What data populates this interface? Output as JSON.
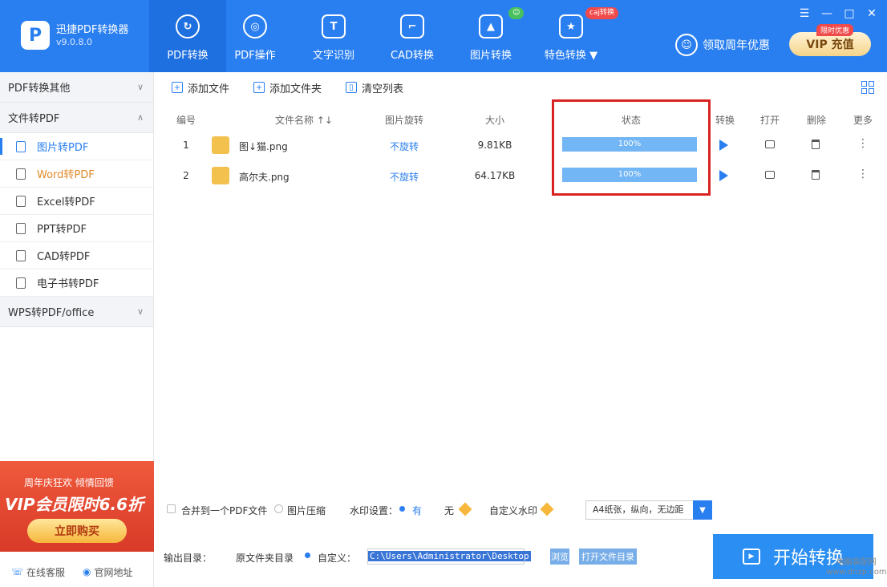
{
  "app": {
    "name": "迅捷PDF转换器",
    "version": "v9.0.8.0",
    "logo_letter": "P"
  },
  "nav": [
    {
      "label": "PDF转换",
      "icon": "refresh-icon"
    },
    {
      "label": "PDF操作",
      "icon": "target-icon"
    },
    {
      "label": "文字识别",
      "icon": "text-scan-icon"
    },
    {
      "label": "CAD转换",
      "icon": "cad-icon"
    },
    {
      "label": "图片转换",
      "icon": "image-icon"
    },
    {
      "label": "特色转换",
      "icon": "star-icon",
      "chevron": "▼"
    }
  ],
  "badges": {
    "green": "☺",
    "red": "caj转换"
  },
  "promo": {
    "text": "领取周年优惠",
    "vip_label": "VIP 充值",
    "vip_tag": "限时优惠"
  },
  "window_controls": {
    "menu": "☰",
    "minimize": "—",
    "maximize": "□",
    "close": "✕"
  },
  "sidebar": {
    "group1": "PDF转换其他",
    "group2": "文件转PDF",
    "items": [
      "图片转PDF",
      "Word转PDF",
      "Excel转PDF",
      "PPT转PDF",
      "CAD转PDF",
      "电子书转PDF"
    ],
    "group3": "WPS转PDF/office",
    "ad": {
      "line1": "周年庆狂欢 倾情回馈",
      "line2": "VIP会员限时6.6折",
      "button": "立即购买"
    },
    "footer": {
      "support": "在线客服",
      "website": "官网地址"
    }
  },
  "toolbar": {
    "add_file": "添加文件",
    "add_folder": "添加文件夹",
    "clear_list": "清空列表"
  },
  "table": {
    "headers": {
      "num": "编号",
      "name": "文件名称",
      "sort": "↑↓",
      "rotate": "图片旋转",
      "size": "大小",
      "status": "状态",
      "convert": "转换",
      "open": "打开",
      "delete": "删除",
      "more": "更多"
    },
    "rows": [
      {
        "num": "1",
        "name": "图↓猫.png",
        "rotate": "不旋转",
        "size": "9.81KB",
        "progress": 100,
        "status": "100%"
      },
      {
        "num": "2",
        "name": "高尔夫.png",
        "rotate": "不旋转",
        "size": "64.17KB",
        "progress": 100,
        "status": "100%"
      }
    ]
  },
  "options": {
    "merge": "合并到一个PDF文件",
    "compress": "图片压缩",
    "watermark_label": "水印设置：",
    "watermark_yes": "有",
    "watermark_no": "无",
    "custom_watermark": "自定义水印",
    "page_setting": "A4纸张，纵向，无边距",
    "dropdown_arrow": "▼"
  },
  "output": {
    "label": "输出目录：",
    "source_dir": "原文件夹目录",
    "custom": "自定义：",
    "path": "C:\\Users\\Administrator\\Desktop",
    "browse": "浏览",
    "open_dir": "打开文件目录",
    "start": "开始转换"
  },
  "watermark": {
    "line1": "电脑装配网",
    "line2": "www.dnzp.com"
  },
  "colors": {
    "primary": "#2a7ff0",
    "highlight": "#d92323",
    "progress": "#72b6f5"
  }
}
